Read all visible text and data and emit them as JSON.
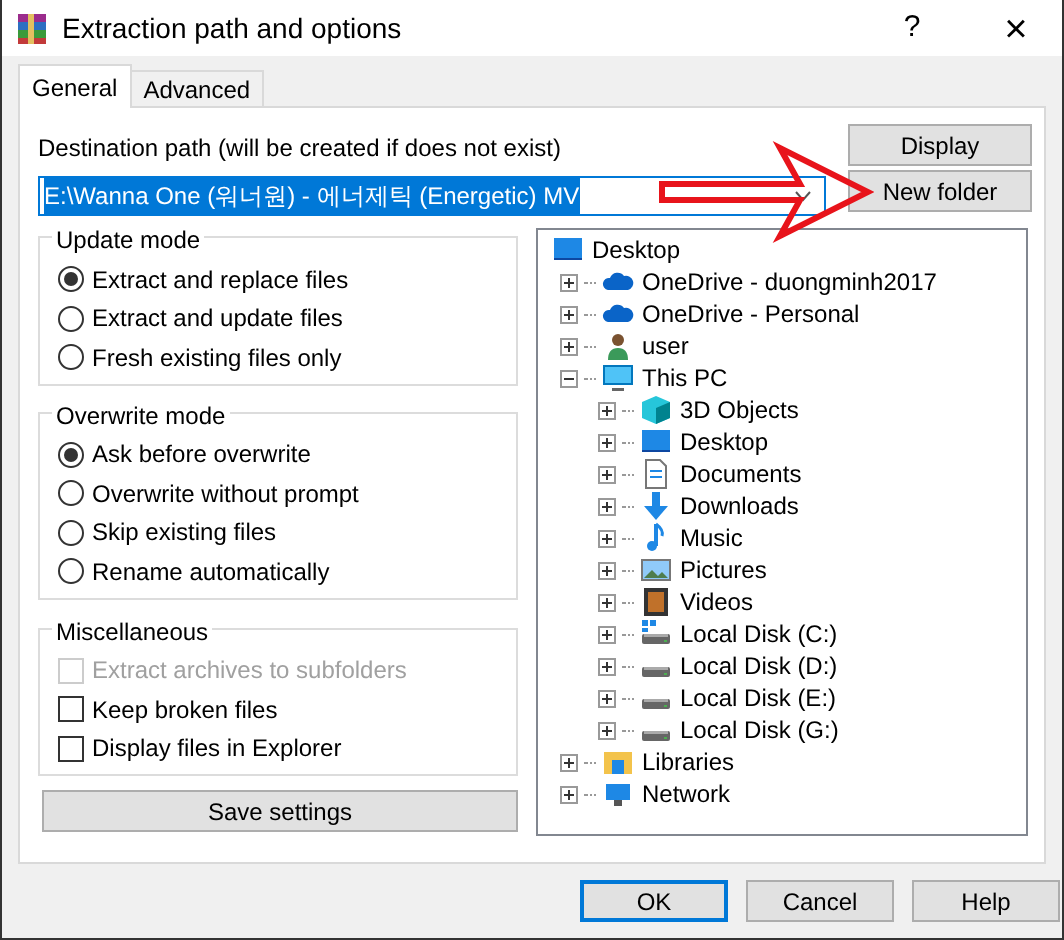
{
  "window": {
    "title": "Extraction path and options",
    "help": "?",
    "close": "×"
  },
  "tabs": [
    {
      "label": "General",
      "selected": true
    },
    {
      "label": "Advanced",
      "selected": false
    }
  ],
  "destination": {
    "label": "Destination path (will be created if does not exist)",
    "value": "E:\\Wanna One (워너원) - 에너제틱 (Energetic) MV",
    "selected": true
  },
  "side_buttons": [
    "Display",
    "New folder"
  ],
  "groups": [
    {
      "title": "Update mode",
      "items": [
        {
          "kind": "radio",
          "label": "Extract and replace files",
          "selected": true,
          "disabled": false
        },
        {
          "kind": "radio",
          "label": "Extract and update files",
          "selected": false,
          "disabled": false
        },
        {
          "kind": "radio",
          "label": "Fresh existing files only",
          "selected": false,
          "disabled": false
        }
      ]
    },
    {
      "title": "Overwrite mode",
      "items": [
        {
          "kind": "radio",
          "label": "Ask before overwrite",
          "selected": true,
          "disabled": false
        },
        {
          "kind": "radio",
          "label": "Overwrite without prompt",
          "selected": false,
          "disabled": false
        },
        {
          "kind": "radio",
          "label": "Skip existing files",
          "selected": false,
          "disabled": false
        },
        {
          "kind": "radio",
          "label": "Rename automatically",
          "selected": false,
          "disabled": false
        }
      ]
    },
    {
      "title": "Miscellaneous",
      "items": [
        {
          "kind": "checkbox",
          "label": "Extract archives to subfolders",
          "checked": false,
          "disabled": true
        },
        {
          "kind": "checkbox",
          "label": "Keep broken files",
          "checked": false,
          "disabled": false
        },
        {
          "kind": "checkbox",
          "label": "Display files in Explorer",
          "checked": false,
          "disabled": false
        }
      ]
    }
  ],
  "save_button": "Save settings",
  "tree": [
    {
      "label": "Desktop",
      "kind": "desktop",
      "children": [
        {
          "label": "OneDrive - duongminh2017",
          "kind": "cloud",
          "expanded": false
        },
        {
          "label": "OneDrive - Personal",
          "kind": "cloud",
          "expanded": false
        },
        {
          "label": "user",
          "kind": "user",
          "expanded": false
        },
        {
          "label": "This PC",
          "kind": "pc",
          "expanded": true,
          "children": [
            {
              "label": "3D Objects",
              "kind": "cube",
              "expanded": false
            },
            {
              "label": "Desktop",
              "kind": "desktop",
              "expanded": false
            },
            {
              "label": "Documents",
              "kind": "document",
              "expanded": false
            },
            {
              "label": "Downloads",
              "kind": "download",
              "expanded": false
            },
            {
              "label": "Music",
              "kind": "music",
              "expanded": false
            },
            {
              "label": "Pictures",
              "kind": "pictures",
              "expanded": false
            },
            {
              "label": "Videos",
              "kind": "videos",
              "expanded": false
            },
            {
              "label": "Local Disk (C:)",
              "kind": "diskwin",
              "expanded": false
            },
            {
              "label": "Local Disk (D:)",
              "kind": "disk",
              "expanded": false
            },
            {
              "label": "Local Disk (E:)",
              "kind": "disk",
              "expanded": false
            },
            {
              "label": "Local Disk (G:)",
              "kind": "disk",
              "expanded": false
            }
          ]
        },
        {
          "label": "Libraries",
          "kind": "library",
          "expanded": false
        },
        {
          "label": "Network",
          "kind": "network",
          "expanded": false
        }
      ]
    }
  ],
  "dialog_buttons": [
    {
      "label": "OK",
      "default": true
    },
    {
      "label": "Cancel",
      "default": false
    },
    {
      "label": "Help",
      "default": false
    }
  ]
}
